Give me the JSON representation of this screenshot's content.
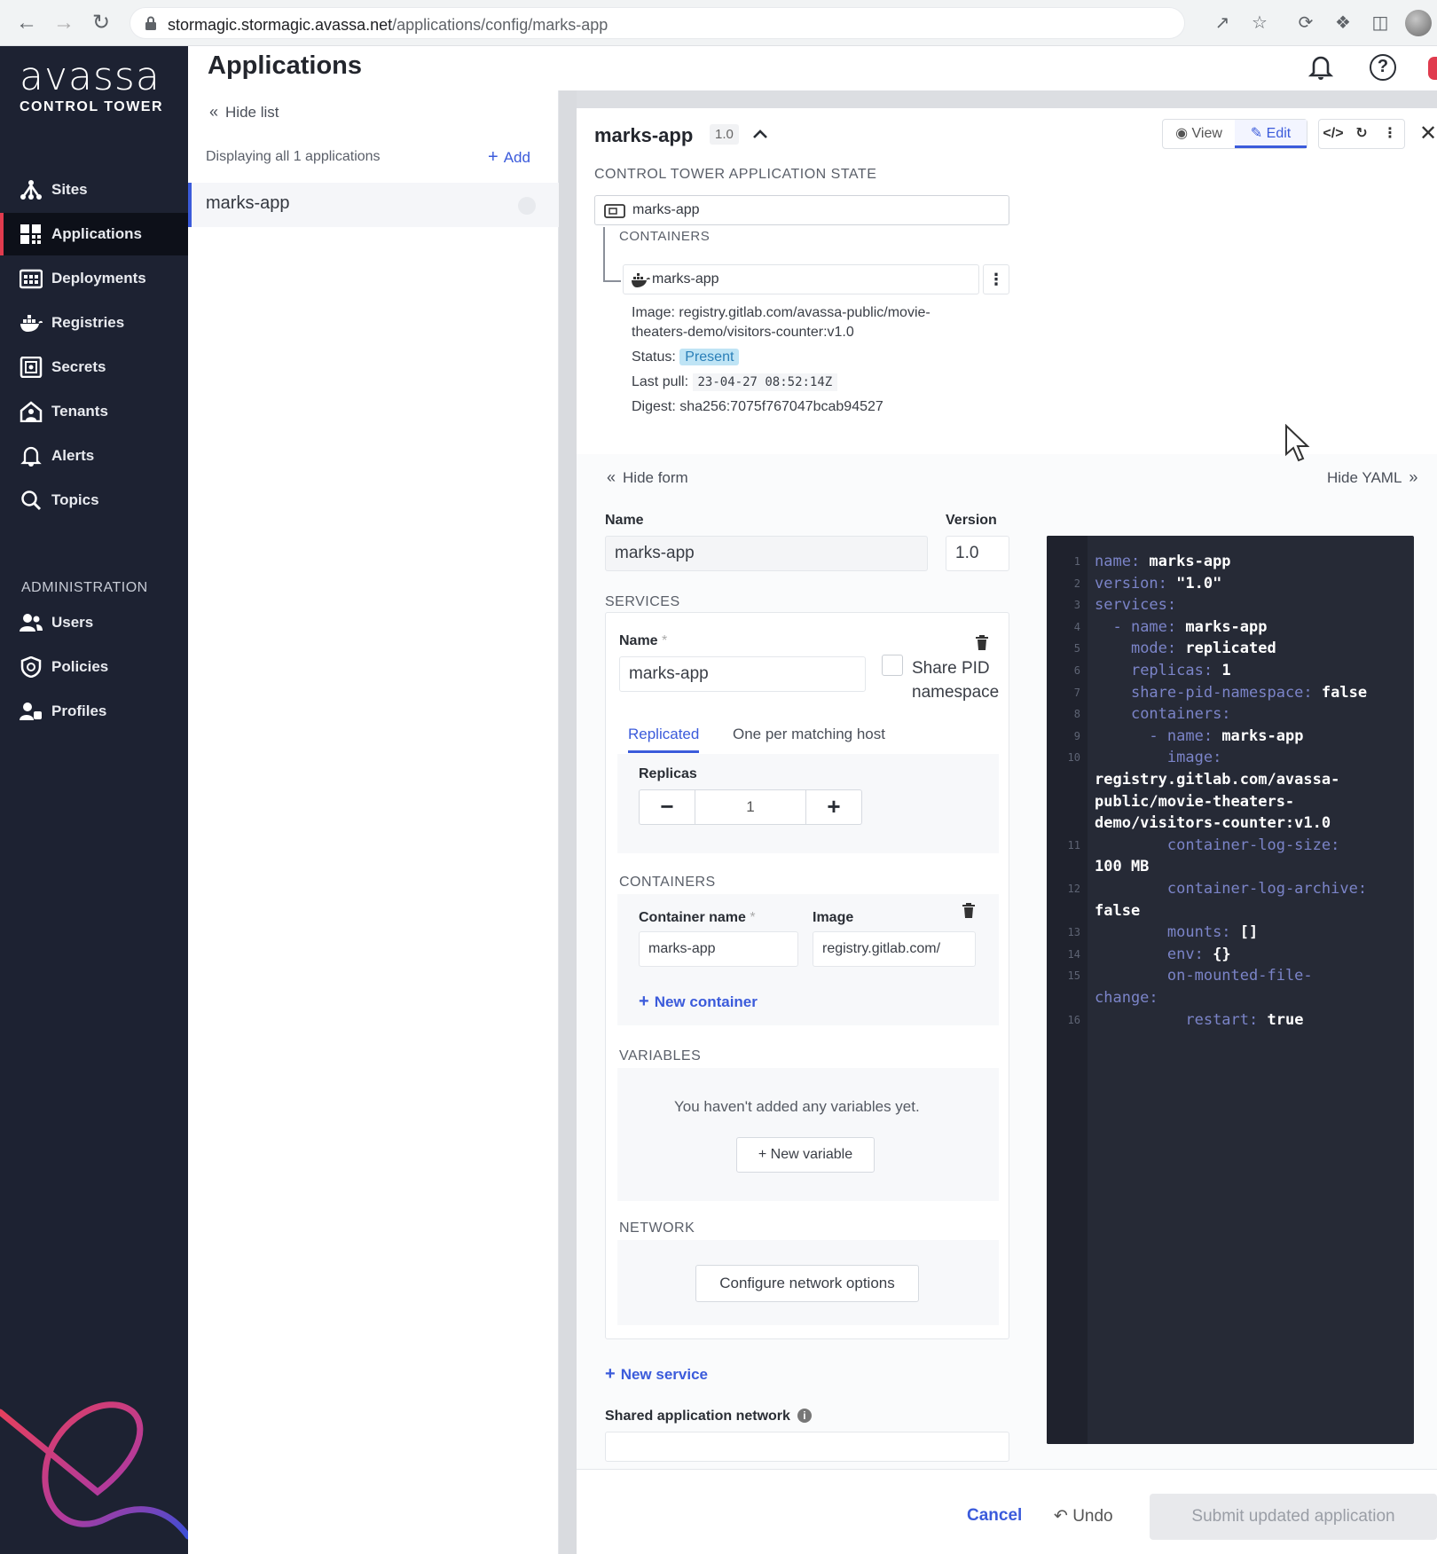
{
  "browser": {
    "url_host": "stormagic.stormagic.avassa.net",
    "url_path": "/applications/config/marks-app"
  },
  "brand": {
    "logo": "avassa",
    "subtitle": "CONTROL TOWER"
  },
  "nav": {
    "items": [
      {
        "label": "Sites",
        "icon": "sites-icon"
      },
      {
        "label": "Applications",
        "icon": "applications-icon",
        "active": true
      },
      {
        "label": "Deployments",
        "icon": "deployments-icon"
      },
      {
        "label": "Registries",
        "icon": "registries-icon"
      },
      {
        "label": "Secrets",
        "icon": "secrets-icon"
      },
      {
        "label": "Tenants",
        "icon": "tenants-icon"
      },
      {
        "label": "Alerts",
        "icon": "alerts-icon"
      },
      {
        "label": "Topics",
        "icon": "topics-icon"
      }
    ],
    "admin_heading": "ADMINISTRATION",
    "admin_items": [
      {
        "label": "Users",
        "icon": "users-icon"
      },
      {
        "label": "Policies",
        "icon": "policies-icon"
      },
      {
        "label": "Profiles",
        "icon": "profiles-icon"
      }
    ]
  },
  "header": {
    "title": "Applications"
  },
  "list": {
    "hide_label": "Hide list",
    "count_text": "Displaying all 1 applications",
    "add_label": "Add",
    "items": [
      {
        "name": "marks-app"
      }
    ]
  },
  "detail": {
    "name": "marks-app",
    "version": "1.0",
    "view_label": "View",
    "edit_label": "Edit",
    "state_heading": "CONTROL TOWER APPLICATION STATE",
    "state_app": "marks-app",
    "containers_heading": "CONTAINERS",
    "container_name": "marks-app",
    "image_line1": "Image: registry.gitlab.com/avassa-public/movie-",
    "image_line2": "theaters-demo/visitors-counter:v1.0",
    "status_label": "Status:",
    "status_value": "Present",
    "last_pull_label": "Last pull:",
    "last_pull_value": "23-04-27 08:52:14Z",
    "digest": "Digest: sha256:7075f767047bcab94527"
  },
  "form": {
    "hide_form": "Hide form",
    "hide_yaml": "Hide YAML",
    "name_label": "Name",
    "name_value": "marks-app",
    "version_label": "Version",
    "version_value": "1.0",
    "services_heading": "SERVICES",
    "service_name_label": "Name",
    "service_name_value": "marks-app",
    "share_pid_line1": "Share PID",
    "share_pid_line2": "namespace",
    "tab_replicated": "Replicated",
    "tab_one_per_host": "One per matching host",
    "replicas_label": "Replicas",
    "replicas_value": "1",
    "containers_heading": "CONTAINERS",
    "container_name_label": "Container name",
    "image_label": "Image",
    "container_name_value": "marks-app",
    "image_value": "registry.gitlab.com/",
    "new_container": "New container",
    "variables_heading": "VARIABLES",
    "variables_empty": "You haven't added any variables yet.",
    "new_variable": "+ New variable",
    "network_heading": "NETWORK",
    "configure_network": "Configure network options",
    "new_service": "New service",
    "shared_network_label": "Shared application network"
  },
  "yaml": {
    "lines": [
      {
        "n": "1",
        "key": "name:",
        "val": " marks-app",
        "indent": ""
      },
      {
        "n": "2",
        "key": "version:",
        "val": " \"1.0\"",
        "indent": ""
      },
      {
        "n": "3",
        "key": "services:",
        "val": "",
        "indent": ""
      },
      {
        "n": "4",
        "key": "- name:",
        "val": " marks-app",
        "indent": "  "
      },
      {
        "n": "5",
        "key": "mode:",
        "val": " replicated",
        "indent": "    "
      },
      {
        "n": "6",
        "key": "replicas:",
        "val": " 1",
        "indent": "    "
      },
      {
        "n": "7",
        "key": "share-pid-namespace:",
        "val": " false",
        "indent": "    "
      },
      {
        "n": "8",
        "key": "containers:",
        "val": "",
        "indent": "    "
      },
      {
        "n": "9",
        "key": "- name:",
        "val": " marks-app",
        "indent": "      "
      },
      {
        "n": "10",
        "key": "image:",
        "val": "",
        "indent": "        "
      },
      {
        "n": "",
        "key": "",
        "val": "registry.gitlab.com/avassa-",
        "indent": ""
      },
      {
        "n": "",
        "key": "",
        "val": "public/movie-theaters-",
        "indent": ""
      },
      {
        "n": "",
        "key": "",
        "val": "demo/visitors-counter:v1.0",
        "indent": ""
      },
      {
        "n": "11",
        "key": "container-log-size:",
        "val": "",
        "indent": "        "
      },
      {
        "n": "",
        "key": "",
        "val": "100 MB",
        "indent": ""
      },
      {
        "n": "12",
        "key": "container-log-archive:",
        "val": "",
        "indent": "        "
      },
      {
        "n": "",
        "key": "",
        "val": "false",
        "indent": ""
      },
      {
        "n": "13",
        "key": "mounts:",
        "val": " []",
        "indent": "        "
      },
      {
        "n": "14",
        "key": "env:",
        "val": " {}",
        "indent": "        "
      },
      {
        "n": "15",
        "key": "on-mounted-file-",
        "val": "",
        "indent": "        "
      },
      {
        "n": "",
        "key": "change:",
        "val": "",
        "indent": ""
      },
      {
        "n": "16",
        "key": "restart:",
        "val": " true",
        "indent": "          "
      }
    ]
  },
  "footer": {
    "cancel": "Cancel",
    "undo": "Undo",
    "submit": "Submit updated application"
  }
}
